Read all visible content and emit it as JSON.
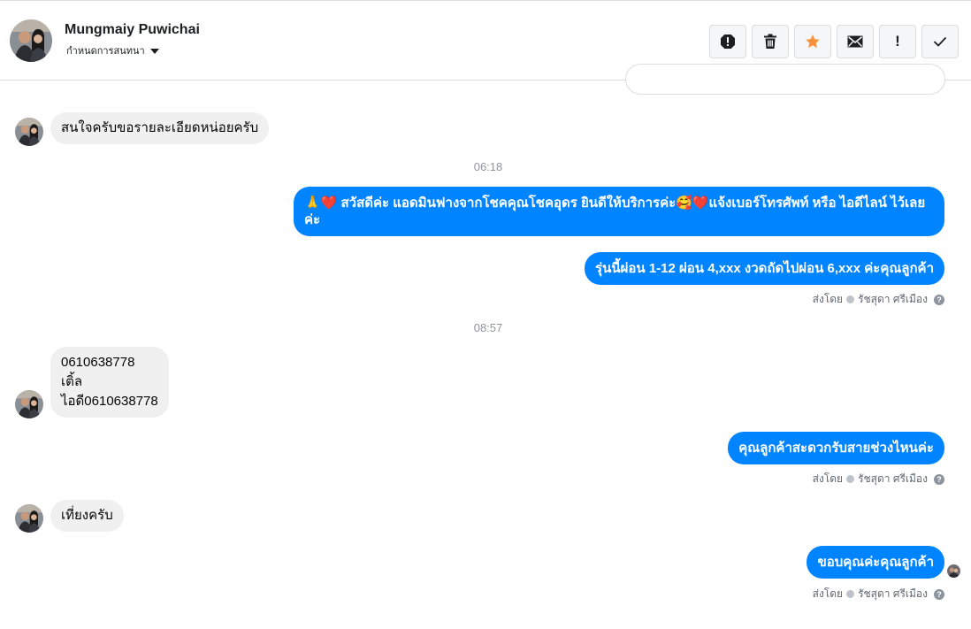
{
  "header": {
    "contact_name": "Mungmaiy Puwichai",
    "assign_label": "กำหนดการสนทนา"
  },
  "toolbar": {
    "buttons": [
      {
        "name": "spam-button",
        "icon": "alert-circle-icon"
      },
      {
        "name": "delete-button",
        "icon": "trash-icon"
      },
      {
        "name": "star-button",
        "icon": "star-icon",
        "color": "#f7923b"
      },
      {
        "name": "mark-unread-button",
        "icon": "envelope-icon"
      },
      {
        "name": "important-button",
        "icon": "exclamation-icon",
        "label": "!"
      },
      {
        "name": "done-button",
        "icon": "check-icon"
      }
    ]
  },
  "colors": {
    "outgoing_bubble": "#0084ff",
    "incoming_bubble": "#f0f0f0",
    "star": "#f7923b"
  },
  "messages": {
    "in_1": "สนใจครับขอรายละเอียดหน่อยครับ",
    "time_1": "06:18",
    "out_1_emoji_a": "🙏❤️",
    "out_1_line1": " สวัสดีค่ะ แอดมินฟางจากโชคคุณโชคอุดร ยินดีให้บริการค่ะ",
    "out_1_emoji_b": "🥰❤️",
    "out_1_line1_end": "แจ้งเบอร์โทรศัพท์ หรือ ไอดีไลน์  ไว้เลย",
    "out_1_line2": "ค่ะ",
    "out_2": "รุ่นนี้ผ่อน 1-12 ผ่อน 4,xxx งวดถัดไปผ่อน 6,xxx ค่ะคุณลูกค้า",
    "time_2": "08:57",
    "in_2_line1": "0610638778",
    "in_2_line2": "เติ้ล",
    "in_2_line3": "ไอดี0610638778",
    "out_3": "คุณลูกค้าสะดวกรับสายช่วงไหนค่ะ",
    "in_3": "เที่ยงครับ",
    "out_4": "ขอบคุณค่ะคุณลูกค้า"
  },
  "sent_by": {
    "prefix": "ส่งโดย",
    "agent": "รัชสุดา ศรีเมือง",
    "help": "?"
  }
}
